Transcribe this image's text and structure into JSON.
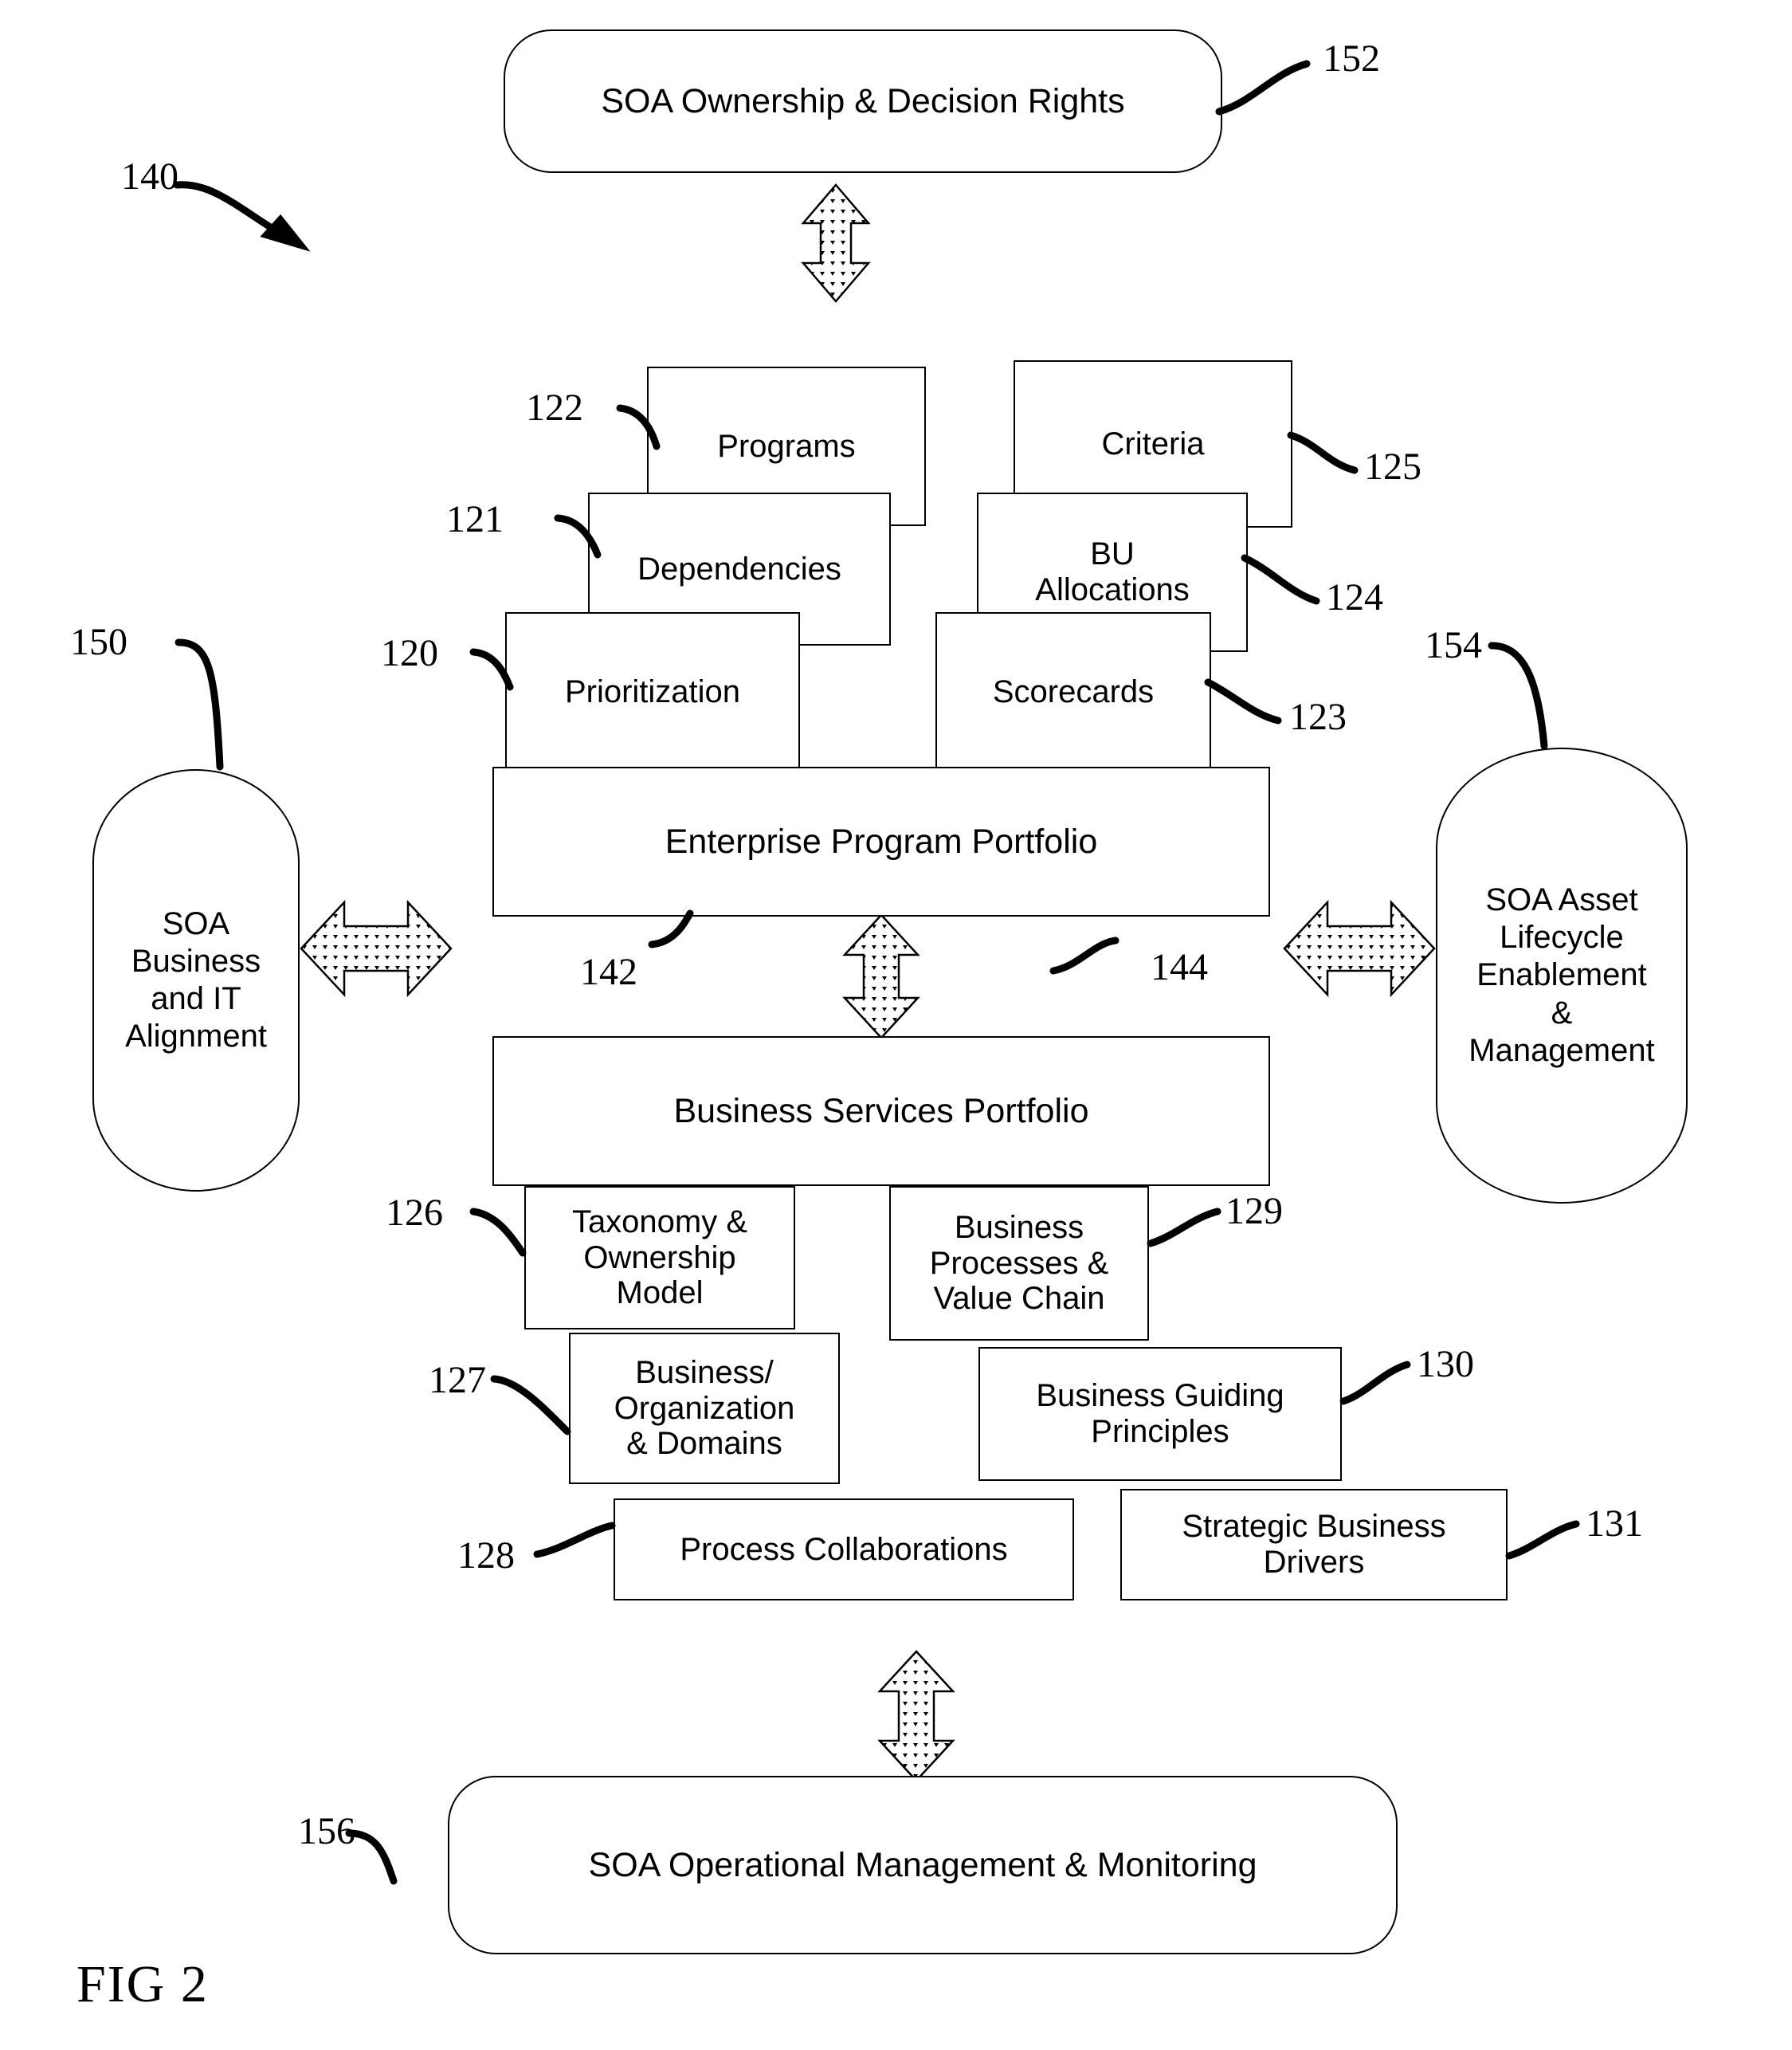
{
  "figure": {
    "caption": "FIG 2",
    "overall_ref": "140"
  },
  "governance": {
    "top": {
      "label": "SOA Ownership & Decision Rights",
      "ref": "152"
    },
    "bottom": {
      "label": "SOA Operational Management & Monitoring",
      "ref": "156"
    },
    "left": {
      "label": "SOA\nBusiness\nand IT\nAlignment",
      "ref": "150"
    },
    "right": {
      "label": "SOA Asset\nLifecycle\nEnablement\n&\nManagement",
      "ref": "154"
    }
  },
  "portfolios": [
    {
      "label": "Enterprise Program Portfolio",
      "ref": "142"
    },
    {
      "label": "Business Services Portfolio",
      "ref": "144"
    }
  ],
  "program_attributes_left": [
    {
      "label": "Programs",
      "ref": "122"
    },
    {
      "label": "Dependencies",
      "ref": "121"
    },
    {
      "label": "Prioritization",
      "ref": "120"
    }
  ],
  "program_attributes_right": [
    {
      "label": "Criteria",
      "ref": "125"
    },
    {
      "label": "BU\nAllocations",
      "ref": "124"
    },
    {
      "label": "Scorecards",
      "ref": "123"
    }
  ],
  "service_attributes_left": [
    {
      "label": "Taxonomy &\nOwnership\nModel",
      "ref": "126"
    },
    {
      "label": "Business/\nOrganization\n& Domains",
      "ref": "127"
    },
    {
      "label": "Process Collaborations",
      "ref": "128"
    }
  ],
  "service_attributes_right": [
    {
      "label": "Business\nProcesses &\nValue Chain",
      "ref": "129"
    },
    {
      "label": "Business Guiding\nPrinciples",
      "ref": "130"
    },
    {
      "label": "Strategic Business\nDrivers",
      "ref": "131"
    }
  ],
  "colors": {
    "line": "#000000",
    "fill": "#ffffff",
    "arrow_fill": "#ffffff",
    "arrow_stroke": "#000000"
  }
}
